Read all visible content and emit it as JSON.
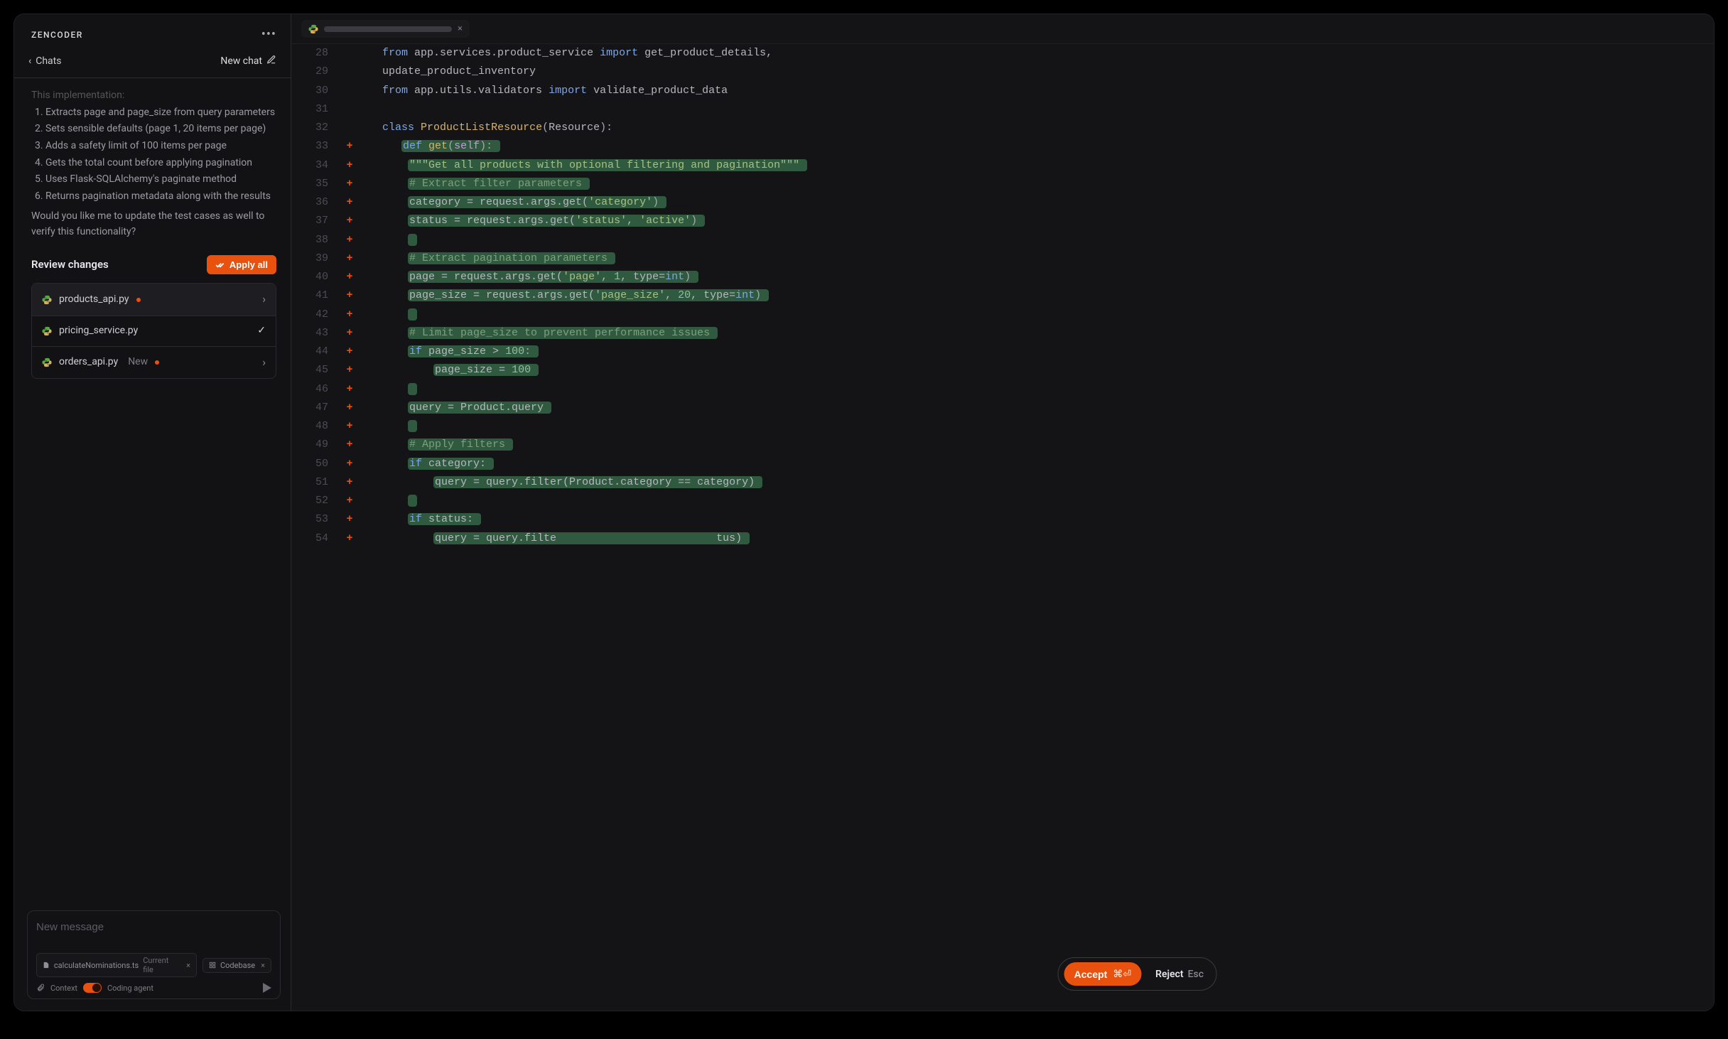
{
  "sidebar": {
    "brand": "ZENCODER",
    "back_label": "Chats",
    "new_chat_label": "New chat",
    "implementation_heading": "This implementation:",
    "implementation_points": [
      "Extracts page and page_size from query parameters",
      "Sets sensible defaults (page 1, 20 items per page)",
      "Adds a safety limit of 100 items per page",
      "Gets the total count before applying pagination",
      "Uses Flask-SQLAlchemy's paginate method",
      "Returns pagination metadata along with the results"
    ],
    "followup_question": "Would you like me to update the test cases as well to verify this functionality?",
    "review_title": "Review changes",
    "apply_all_label": "Apply all",
    "files": [
      {
        "name": "products_api.py",
        "tag": "",
        "dot": true,
        "trailing": "chev"
      },
      {
        "name": "pricing_service.py",
        "tag": "",
        "dot": false,
        "trailing": "check"
      },
      {
        "name": "orders_api.py",
        "tag": "New",
        "dot": true,
        "trailing": "chev"
      }
    ],
    "composer": {
      "placeholder": "New message",
      "chip_file": "calculateNominations.ts",
      "chip_file_note": "Current file",
      "chip_codebase": "Codebase",
      "context_label": "Context",
      "agent_label": "Coding agent"
    }
  },
  "editor": {
    "lines": [
      {
        "n": 28,
        "plus": false,
        "segments": [
          {
            "t": "    ",
            "c": ""
          },
          {
            "t": "from",
            "c": "tk-kw"
          },
          {
            "t": " app.services.product_service ",
            "c": ""
          },
          {
            "t": "import",
            "c": "tk-kw"
          },
          {
            "t": " get_product_details,",
            "c": ""
          }
        ]
      },
      {
        "n": 29,
        "plus": false,
        "segments": [
          {
            "t": "    update_product_inventory",
            "c": ""
          }
        ]
      },
      {
        "n": 30,
        "plus": false,
        "segments": [
          {
            "t": "    ",
            "c": ""
          },
          {
            "t": "from",
            "c": "tk-kw"
          },
          {
            "t": " app.utils.validators ",
            "c": ""
          },
          {
            "t": "import",
            "c": "tk-kw"
          },
          {
            "t": " validate_product_data",
            "c": ""
          }
        ]
      },
      {
        "n": 31,
        "plus": false,
        "segments": [
          {
            "t": "",
            "c": ""
          }
        ]
      },
      {
        "n": 32,
        "plus": false,
        "segments": [
          {
            "t": "    ",
            "c": ""
          },
          {
            "t": "class",
            "c": "tk-cls"
          },
          {
            "t": " ",
            "c": ""
          },
          {
            "t": "ProductListResource",
            "c": "tk-name"
          },
          {
            "t": "(",
            "c": "tk-p"
          },
          {
            "t": "Resource",
            "c": ""
          },
          {
            "t": "):",
            "c": "tk-p"
          }
        ]
      },
      {
        "n": 33,
        "plus": true,
        "hl": true,
        "segments": [
          {
            "t": "       ",
            "c": ""
          },
          {
            "t": "def",
            "c": "tk-def"
          },
          {
            "t": " ",
            "c": ""
          },
          {
            "t": "get",
            "c": "tk-call"
          },
          {
            "t": "(",
            "c": "tk-p"
          },
          {
            "t": "self",
            "c": "tk-self"
          },
          {
            "t": "):",
            "c": "tk-p"
          }
        ]
      },
      {
        "n": 34,
        "plus": true,
        "hl": true,
        "segments": [
          {
            "t": "        ",
            "c": ""
          },
          {
            "t": "\"\"\"Get all products with optional filtering and pagination\"\"\"",
            "c": "tk-str"
          }
        ]
      },
      {
        "n": 35,
        "plus": true,
        "hl": true,
        "segments": [
          {
            "t": "        ",
            "c": ""
          },
          {
            "t": "# Extract filter parameters",
            "c": "tk-cmt"
          }
        ]
      },
      {
        "n": 36,
        "plus": true,
        "hl": true,
        "segments": [
          {
            "t": "        category = request.args.get(",
            "c": ""
          },
          {
            "t": "'category'",
            "c": "tk-str"
          },
          {
            "t": ")",
            "c": "tk-p"
          }
        ]
      },
      {
        "n": 37,
        "plus": true,
        "hl": true,
        "segments": [
          {
            "t": "        status = request.args.get(",
            "c": ""
          },
          {
            "t": "'status'",
            "c": "tk-str"
          },
          {
            "t": ", ",
            "c": ""
          },
          {
            "t": "'active'",
            "c": "tk-str"
          },
          {
            "t": ")",
            "c": "tk-p"
          }
        ]
      },
      {
        "n": 38,
        "plus": true,
        "hl": true,
        "segments": [
          {
            "t": "        ",
            "c": ""
          }
        ]
      },
      {
        "n": 39,
        "plus": true,
        "hl": true,
        "segments": [
          {
            "t": "        ",
            "c": ""
          },
          {
            "t": "# Extract pagination parameters",
            "c": "tk-cmt"
          }
        ]
      },
      {
        "n": 40,
        "plus": true,
        "hl": true,
        "segments": [
          {
            "t": "        page = request.args.get(",
            "c": ""
          },
          {
            "t": "'page'",
            "c": "tk-str"
          },
          {
            "t": ", ",
            "c": ""
          },
          {
            "t": "1",
            "c": "tk-num"
          },
          {
            "t": ", type=",
            "c": ""
          },
          {
            "t": "int",
            "c": "tk-type"
          },
          {
            "t": ")",
            "c": "tk-p"
          }
        ]
      },
      {
        "n": 41,
        "plus": true,
        "hl": true,
        "segments": [
          {
            "t": "        page_size = request.args.get(",
            "c": ""
          },
          {
            "t": "'page_size'",
            "c": "tk-str"
          },
          {
            "t": ", ",
            "c": ""
          },
          {
            "t": "20",
            "c": "tk-num"
          },
          {
            "t": ", type=",
            "c": ""
          },
          {
            "t": "int",
            "c": "tk-type"
          },
          {
            "t": ")",
            "c": "tk-p"
          }
        ]
      },
      {
        "n": 42,
        "plus": true,
        "hl": true,
        "segments": [
          {
            "t": "        ",
            "c": ""
          }
        ]
      },
      {
        "n": 43,
        "plus": true,
        "hl": true,
        "segments": [
          {
            "t": "        ",
            "c": ""
          },
          {
            "t": "# Limit page_size to prevent performance issues",
            "c": "tk-cmt"
          }
        ]
      },
      {
        "n": 44,
        "plus": true,
        "hl": true,
        "segments": [
          {
            "t": "        ",
            "c": ""
          },
          {
            "t": "if",
            "c": "tk-kw"
          },
          {
            "t": " page_size > ",
            "c": ""
          },
          {
            "t": "100",
            "c": "tk-num"
          },
          {
            "t": ":",
            "c": "tk-p"
          }
        ]
      },
      {
        "n": 45,
        "plus": true,
        "hl": true,
        "segments": [
          {
            "t": "            page_size = ",
            "c": ""
          },
          {
            "t": "100",
            "c": "tk-num"
          }
        ]
      },
      {
        "n": 46,
        "plus": true,
        "hl": true,
        "segments": [
          {
            "t": "        ",
            "c": ""
          }
        ]
      },
      {
        "n": 47,
        "plus": true,
        "hl": true,
        "segments": [
          {
            "t": "        query = Product.query",
            "c": ""
          }
        ]
      },
      {
        "n": 48,
        "plus": true,
        "hl": true,
        "segments": [
          {
            "t": "        ",
            "c": ""
          }
        ]
      },
      {
        "n": 49,
        "plus": true,
        "hl": true,
        "segments": [
          {
            "t": "        ",
            "c": ""
          },
          {
            "t": "# Apply filters",
            "c": "tk-cmt"
          }
        ]
      },
      {
        "n": 50,
        "plus": true,
        "hl": true,
        "segments": [
          {
            "t": "        ",
            "c": ""
          },
          {
            "t": "if",
            "c": "tk-kw"
          },
          {
            "t": " category:",
            "c": ""
          }
        ]
      },
      {
        "n": 51,
        "plus": true,
        "hl": true,
        "segments": [
          {
            "t": "            query = query.filter(Product.category == category)",
            "c": ""
          }
        ]
      },
      {
        "n": 52,
        "plus": true,
        "hl": true,
        "segments": [
          {
            "t": "        ",
            "c": ""
          }
        ]
      },
      {
        "n": 53,
        "plus": true,
        "hl": true,
        "segments": [
          {
            "t": "        ",
            "c": ""
          },
          {
            "t": "if",
            "c": "tk-kw"
          },
          {
            "t": " status:",
            "c": ""
          }
        ]
      },
      {
        "n": 54,
        "plus": true,
        "hl": true,
        "segments": [
          {
            "t": "            query = query.filte",
            "c": ""
          },
          {
            "t": "                         ",
            "c": "",
            "gap": true
          },
          {
            "t": "tus)",
            "c": ""
          }
        ]
      }
    ],
    "bubble": {
      "accept": "Accept",
      "accept_kbd": "⌘⏎",
      "reject": "Reject",
      "reject_kbd": "Esc"
    }
  }
}
